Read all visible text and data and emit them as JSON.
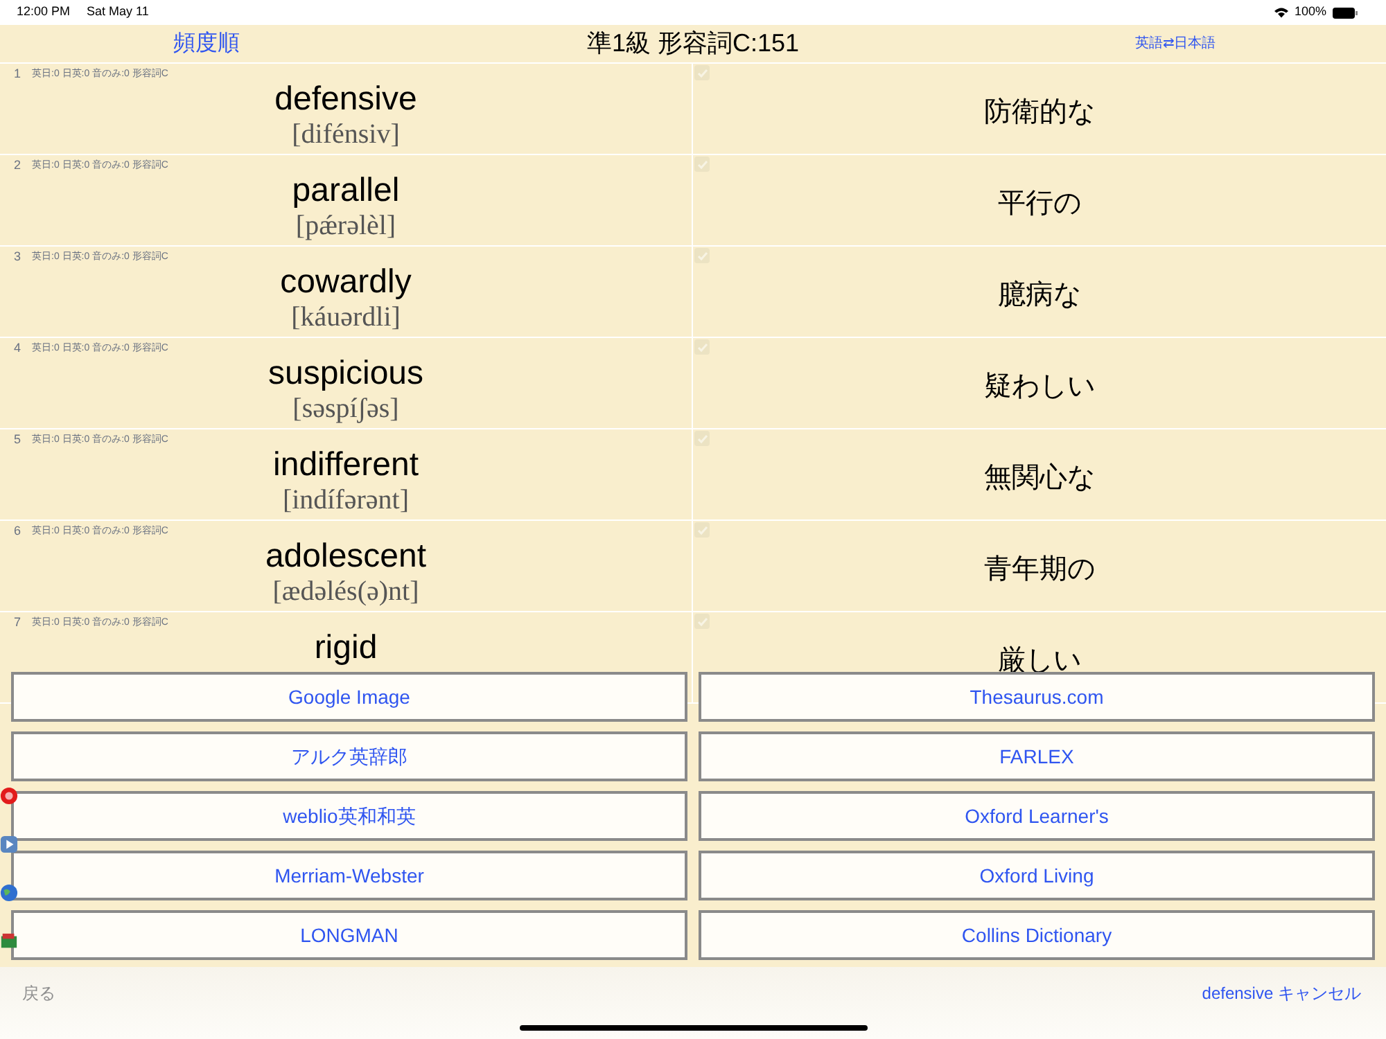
{
  "status_bar": {
    "time": "12:00 PM",
    "date": "Sat May 11",
    "battery": "100%"
  },
  "header": {
    "sort_button": "頻度順",
    "title": "準1級 形容詞C:151",
    "toggle_button": "英語⇄日本語"
  },
  "rows": [
    {
      "number": "1",
      "stats": "英日:0 日英:0 音のみ:0 形容詞C",
      "word": "defensive",
      "reading": "[difénsiv]",
      "meaning": "防衛的な",
      "checked": true
    },
    {
      "number": "2",
      "stats": "英日:0 日英:0 音のみ:0 形容詞C",
      "word": "parallel",
      "reading": "[pǽrəlèl]",
      "meaning": "平行の",
      "checked": true
    },
    {
      "number": "3",
      "stats": "英日:0 日英:0 音のみ:0 形容詞C",
      "word": "cowardly",
      "reading": "[káuərdli]",
      "meaning": "臆病な",
      "checked": true
    },
    {
      "number": "4",
      "stats": "英日:0 日英:0 音のみ:0 形容詞C",
      "word": "suspicious",
      "reading": "[səspíʃəs]",
      "meaning": "疑わしい",
      "checked": true
    },
    {
      "number": "5",
      "stats": "英日:0 日英:0 音のみ:0 形容詞C",
      "word": "indifferent",
      "reading": "[indífərənt]",
      "meaning": "無関心な",
      "checked": true
    },
    {
      "number": "6",
      "stats": "英日:0 日英:0 音のみ:0 形容詞C",
      "word": "adolescent",
      "reading": "[ædəlés(ə)nt]",
      "meaning": "青年期の",
      "checked": true
    },
    {
      "number": "7",
      "stats": "英日:0 日英:0 音のみ:0 形容詞C",
      "word": "rigid",
      "meaning": "厳しい",
      "checked": true
    }
  ],
  "dictionary_buttons": [
    {
      "left": "Google Image",
      "right": "Thesaurus.com"
    },
    {
      "left": "アルク英辞郎",
      "right": "FARLEX"
    },
    {
      "left": "weblio英和和英",
      "right": "Oxford Learner's"
    },
    {
      "left": "Merriam-Webster",
      "right": "Oxford Living"
    },
    {
      "left": "LONGMAN",
      "right": "Collins Dictionary"
    }
  ],
  "side_icons": [
    {
      "kind": "badge"
    },
    {
      "kind": "play"
    },
    {
      "kind": "globe"
    },
    {
      "kind": "book"
    }
  ],
  "footer": {
    "back_button": {
      "label": "戻る",
      "disabled": true
    },
    "word": "defensive",
    "cancel_button": "キャンセル"
  }
}
